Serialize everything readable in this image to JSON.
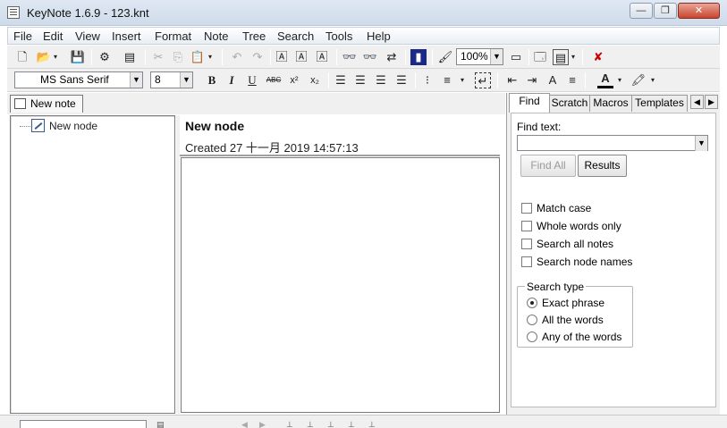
{
  "window": {
    "title": "KeyNote 1.6.9 - 123.knt",
    "minimize_glyph": "—",
    "restore_glyph": "❐",
    "close_glyph": "✕"
  },
  "menu": [
    "File",
    "Edit",
    "View",
    "Insert",
    "Format",
    "Note",
    "Tree",
    "Search",
    "Tools",
    "Help"
  ],
  "toolbar1": {
    "zoom": "100%"
  },
  "toolbar2": {
    "font": "MS Sans Serif",
    "size": "8"
  },
  "tabs": {
    "note_tab": "New note"
  },
  "tree": {
    "node_label": "New node"
  },
  "note": {
    "title": "New node",
    "created": "Created 27 十一月 2019 14:57:13"
  },
  "right_panel": {
    "tabs": [
      "Find",
      "Scratch",
      "Macros",
      "Templates"
    ],
    "find_label": "Find text:",
    "find_all": "Find All",
    "results": "Results",
    "options": [
      "Match case",
      "Whole words only",
      "Search all notes",
      "Search node names"
    ],
    "search_type_label": "Search type",
    "search_types": [
      "Exact phrase",
      "All the words",
      "Any of the words"
    ],
    "selected_search_type": "Exact phrase"
  },
  "colors": {
    "title_bar": "#dfe8f3",
    "close_button": "#c8452e",
    "panel_bg": "#f0f0f0"
  },
  "icons": {
    "bold": "B",
    "italic": "I",
    "underline": "U",
    "strike": "ABC",
    "superscript": "x²",
    "subscript": "x₂",
    "delete": "✘",
    "find": "🔭",
    "font_color": "A"
  }
}
